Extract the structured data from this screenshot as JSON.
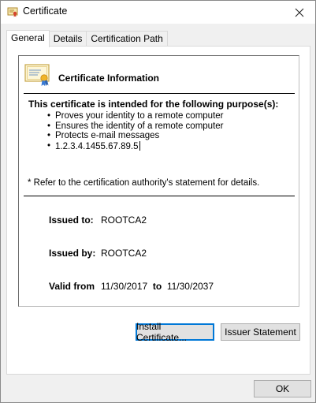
{
  "window": {
    "title": "Certificate",
    "icon": "certificate-icon",
    "close_icon": "close-icon"
  },
  "tabs": [
    {
      "label": "General",
      "active": true
    },
    {
      "label": "Details",
      "active": false
    },
    {
      "label": "Certification Path",
      "active": false
    }
  ],
  "info": {
    "heading": "Certificate Information",
    "purpose_heading": "This certificate is intended for the following purpose(s):",
    "purposes": [
      "Proves your identity to a remote computer",
      "Ensures the identity of a remote computer",
      "Protects e-mail messages",
      "1.2.3.4.1455.67.89.5"
    ],
    "refer_note": "* Refer to the certification authority's statement for details.",
    "issued_to_label": "Issued to:",
    "issued_to_value": "ROOTCA2",
    "issued_by_label": "Issued by:",
    "issued_by_value": "ROOTCA2",
    "valid_from_label": "Valid from",
    "valid_from_value": "11/30/2017",
    "valid_to_label": "to",
    "valid_to_value": "11/30/2037"
  },
  "buttons": {
    "install": "Install Certificate...",
    "issuer_statement": "Issuer Statement",
    "ok": "OK"
  },
  "colors": {
    "focus_border": "#0078d7",
    "button_bg": "#e1e1e1",
    "dialog_bg": "#f0f0f0"
  }
}
